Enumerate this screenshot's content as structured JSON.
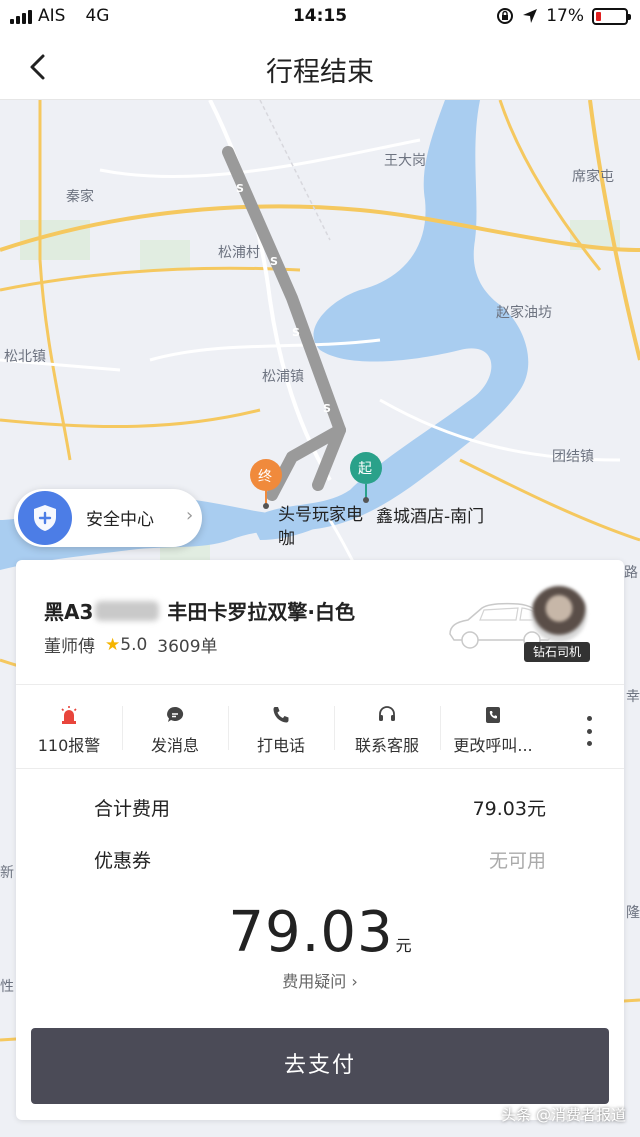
{
  "status_bar": {
    "carrier": "AIS",
    "network": "4G",
    "time": "14:15",
    "battery": "17%",
    "battery_level": 0.17
  },
  "nav": {
    "title": "行程结束",
    "back_icon": "chevron-left-icon"
  },
  "map": {
    "place_labels": [
      "王大岗",
      "席家屯",
      "秦家",
      "松浦村",
      "赵家油坊",
      "松北镇",
      "松浦镇",
      "团结镇"
    ],
    "start_marker": "起",
    "end_marker": "终",
    "end_poi": "头号玩家电",
    "end_poi_cont": "咖",
    "start_poi": "鑫城酒店-南门",
    "edge_labels": [
      "路",
      "幸",
      "新",
      "隆",
      "性"
    ],
    "route_color": "#9a9a9a"
  },
  "safety": {
    "label": "安全中心",
    "icon": "shield-plus-icon"
  },
  "trip": {
    "plate_prefix": "黑A3",
    "car_model": "丰田卡罗拉双擎·白色",
    "driver_name": "董师傅",
    "rating": "5.0",
    "orders": "3609单",
    "badge": "钻石司机"
  },
  "actions": [
    {
      "label": "110报警",
      "icon": "alarm-light-icon",
      "color": "#e8453c"
    },
    {
      "label": "发消息",
      "icon": "message-icon",
      "color": "#444444"
    },
    {
      "label": "打电话",
      "icon": "phone-icon",
      "color": "#444444"
    },
    {
      "label": "联系客服",
      "icon": "headset-icon",
      "color": "#444444"
    },
    {
      "label": "更改呼叫...",
      "icon": "call-change-icon",
      "color": "#444444"
    }
  ],
  "fees": {
    "total_label": "合计费用",
    "total_value": "79.03元",
    "coupon_label": "优惠券",
    "coupon_value": "无可用",
    "big_amount": "79.03",
    "big_unit": "元",
    "question": "费用疑问"
  },
  "pay": {
    "label": "去支付",
    "color": "#4b4b57"
  },
  "watermark": "头条 @消费者报道"
}
